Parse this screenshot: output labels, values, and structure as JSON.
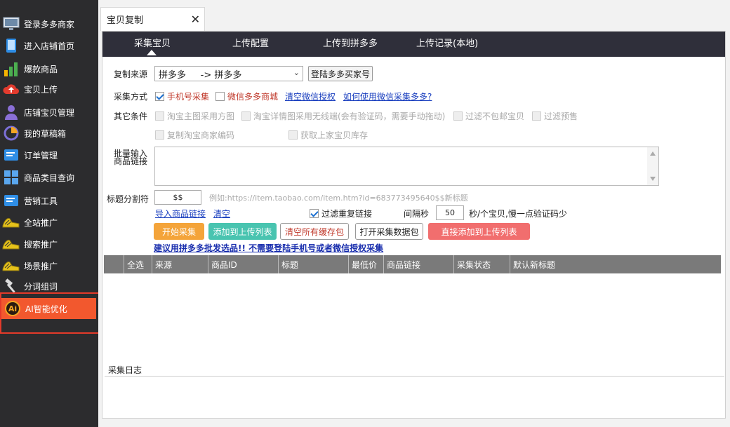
{
  "sidebar": {
    "items": [
      {
        "label": "登录多多商家",
        "icon": "monitor-icon"
      },
      {
        "label": "进入店铺首页",
        "icon": "phone-icon"
      },
      {
        "label": "爆款商品",
        "icon": "bar-chart-icon"
      },
      {
        "label": "宝贝上传",
        "icon": "cloud-upload-icon"
      },
      {
        "label": "店铺宝贝管理",
        "icon": "user-icon"
      },
      {
        "label": "我的草稿箱",
        "icon": "pie-chart-icon"
      },
      {
        "label": "订单管理",
        "icon": "document-icon"
      },
      {
        "label": "商品类目查询",
        "icon": "grid-icon"
      },
      {
        "label": "营销工具",
        "icon": "document-icon"
      },
      {
        "label": "全站推广",
        "icon": "sneaker-icon"
      },
      {
        "label": "搜索推广",
        "icon": "sneaker-icon"
      },
      {
        "label": "场景推广",
        "icon": "sneaker-icon"
      },
      {
        "label": "分词组词",
        "icon": "hammer-icon"
      },
      {
        "label": "AI智能优化",
        "icon": "ai-icon",
        "icon_text": "Ai"
      }
    ]
  },
  "tab": {
    "title": "宝贝复制",
    "close": "✕"
  },
  "subtabs": [
    "采集宝贝",
    "上传配置",
    "上传到拼多多",
    "上传记录(本地)"
  ],
  "form": {
    "source_label": "复制来源",
    "source_value": "拼多多     -> 拼多多",
    "login_button": "登陆多多买家号",
    "method_label": "采集方式",
    "method_phone": "手机号采集",
    "method_wechat": "微信多多商城",
    "clear_wechat": "清空微信授权",
    "how_wechat": "如何使用微信采集多多?",
    "other_label": "其它条件",
    "opt1": "淘宝主图采用方图",
    "opt2": "淘宝详情图采用无线端(会有验证码，需要手动拖动)",
    "opt3": "过滤不包邮宝贝",
    "opt4": "过滤预售",
    "opt5": "复制淘宝商家编码",
    "opt6": "获取上家宝贝库存",
    "batch_label_1": "批量输入",
    "batch_label_2": "商品链接",
    "sep_label": "标题分割符",
    "sep_value": "$$",
    "sep_example": "例如:https://item.taobao.com/item.htm?id=683773495640$$新标题",
    "import_link": "导入商品链接",
    "clear_link": "清空",
    "filter_dup": "过滤重复链接",
    "interval_label": "间隔秒",
    "interval_value": "50",
    "interval_note": "秒/个宝贝,慢一点验证码少"
  },
  "actions": {
    "start": "开始采集",
    "add_upload": "添加到上传列表",
    "clear_cache": "清空所有缓存包",
    "open_pkg": "打开采集数据包",
    "direct_add": "直接添加到上传列表"
  },
  "notice": "建议用拼多多批发选品!! 不需要登陆手机号或者微信授权采集",
  "table": {
    "columns": [
      "全选",
      "来源",
      "商品ID",
      "标题",
      "最低价",
      "商品链接",
      "采集状态",
      "默认新标题"
    ]
  },
  "log": {
    "label": "采集日志"
  },
  "colors": {
    "active_item": "#f2582e",
    "start_button": "#f4a43a",
    "add_button": "#49c4b0",
    "direct_button": "#f16e6e",
    "annotation": "#e43a2a"
  }
}
